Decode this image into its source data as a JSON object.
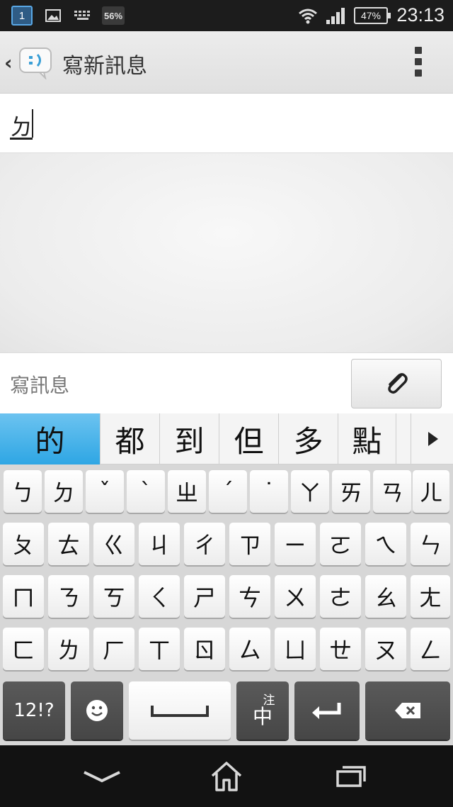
{
  "status_bar": {
    "calendar_day": "1",
    "badge_56": "56%",
    "battery": "47%",
    "time": "23:13",
    "icons": [
      "calendar-icon",
      "picture-icon",
      "keyboard-icon",
      "wifi-icon",
      "signal-icon",
      "battery-icon"
    ]
  },
  "action_bar": {
    "back": "‹",
    "title": "寫新訊息"
  },
  "recipient": {
    "value": "ㄉ"
  },
  "compose": {
    "placeholder": "寫訊息"
  },
  "candidates": [
    "的",
    "都",
    "到",
    "但",
    "多",
    "點"
  ],
  "keyboard": {
    "rows": [
      [
        "ㄅ",
        "ㄉ",
        "ˇ",
        "ˋ",
        "ㄓ",
        "ˊ",
        "˙",
        "ㄚ",
        "ㄞ",
        "ㄢ",
        "ㄦ"
      ],
      [
        "ㄆ",
        "ㄊ",
        "ㄍ",
        "ㄐ",
        "ㄔ",
        "ㄗ",
        "ㄧ",
        "ㄛ",
        "ㄟ",
        "ㄣ"
      ],
      [
        "ㄇ",
        "ㄋ",
        "ㄎ",
        "ㄑ",
        "ㄕ",
        "ㄘ",
        "ㄨ",
        "ㄜ",
        "ㄠ",
        "ㄤ"
      ],
      [
        "ㄈ",
        "ㄌ",
        "ㄏ",
        "ㄒ",
        "ㄖ",
        "ㄙ",
        "ㄩ",
        "ㄝ",
        "ㄡ",
        "ㄥ"
      ]
    ],
    "symbols_label": "12!?",
    "lang_top": "注",
    "lang_bottom": "中"
  },
  "colors": {
    "accent": "#2ea6e4",
    "status_bar": "#1c1c1c",
    "nav_bar": "#121212"
  }
}
